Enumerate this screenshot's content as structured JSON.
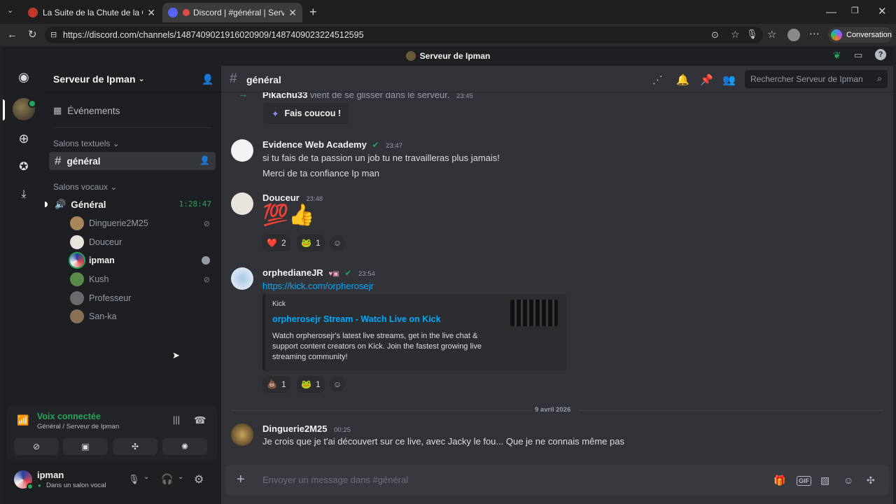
{
  "browser": {
    "tabs": [
      {
        "title": "La Suite de la Chute de la Cabale",
        "close": "✕"
      },
      {
        "title": "Discord | #général | Serveur de Ipman",
        "close": "✕"
      }
    ],
    "new_tab": "+",
    "url": "https://discord.com/channels/1487409021916020909/1487409023224512595",
    "conversation_label": "Conversation"
  },
  "discord": {
    "window_title": "Serveur de Ipman",
    "server_name": "Serveur de Ipman",
    "events_label": "Événements",
    "text_category": "Salons textuels",
    "text_channel": "général",
    "voice_category": "Salons vocaux",
    "voice_channel": "Général",
    "voice_timer": "1:28:47",
    "voice_members": [
      {
        "name": "Dinguerie2M25",
        "muted": true
      },
      {
        "name": "Douceur",
        "muted": false
      },
      {
        "name": "ipman",
        "muted": false
      },
      {
        "name": "Kush",
        "muted": true
      },
      {
        "name": "Professeur",
        "muted": false
      },
      {
        "name": "San-ka",
        "muted": false
      }
    ],
    "voice_panel": {
      "status": "Voix connectée",
      "location": "Général / Serveur de Ipman"
    },
    "user": {
      "name": "ipman",
      "status": "Dans un salon vocal"
    },
    "channel_header": {
      "name": "général",
      "search_placeholder": "Rechercher Serveur de Ipman"
    },
    "messages": {
      "system_partial": {
        "author": "Pikachu33",
        "text": "vient de se glisser dans le serveur.",
        "time": "23:45",
        "button": "Fais coucou !"
      },
      "m1": {
        "author": "Evidence Web Academy",
        "time": "23:47",
        "lines": [
          "si tu fais de ta passion un job tu ne travailleras plus jamais!",
          "Merci de ta confiance Ip man"
        ]
      },
      "m2": {
        "author": "Douceur",
        "time": "23:48",
        "emoji": "💯👍",
        "reactions": [
          {
            "emoji": "❤️",
            "count": "2"
          },
          {
            "emoji": "🐸",
            "count": "1"
          }
        ]
      },
      "m3": {
        "author": "orphedianeJR",
        "time": "23:54",
        "link": "https://kick.com/orpherosejr",
        "embed": {
          "provider": "Kick",
          "title": "orpherosejr Stream - Watch Live on Kick",
          "description": "Watch orpherosejr's latest live streams, get in the live chat & support content creators on Kick. Join the fastest growing live streaming community!"
        },
        "reactions": [
          {
            "emoji": "💩",
            "count": "1"
          },
          {
            "emoji": "🐸",
            "count": "1"
          }
        ]
      },
      "date_divider": "9 avril 2026",
      "m4": {
        "author": "Dinguerie2M25",
        "time": "00:25",
        "text": "Je crois que je t'ai découvert sur ce live, avec Jacky le fou... Que je ne connais même pas"
      }
    },
    "composer_placeholder": "Envoyer un message dans #général"
  },
  "colors": {
    "accent_green": "#23a55a",
    "link_blue": "#00a8fc",
    "bg_main": "#313338",
    "bg_sidebar": "#1e1f22"
  }
}
